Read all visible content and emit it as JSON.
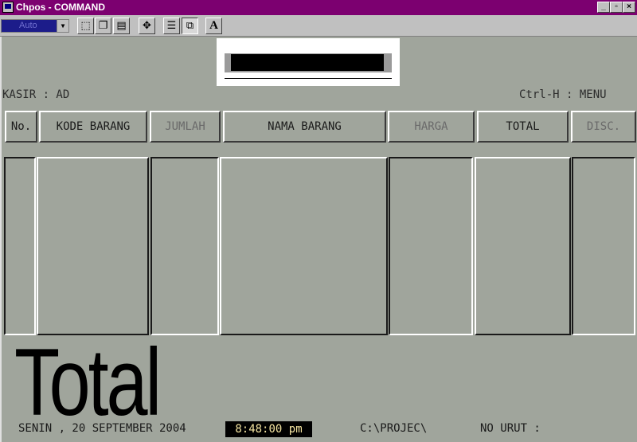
{
  "window": {
    "title": "Chpos - COMMAND",
    "controls": [
      "_",
      "▫",
      "×"
    ]
  },
  "toolbar": {
    "font_size_select": "Auto",
    "buttons": [
      {
        "name": "mark-button",
        "glyph": "⬚"
      },
      {
        "name": "copy-button",
        "glyph": "❐"
      },
      {
        "name": "paste-button",
        "glyph": "▤"
      },
      {
        "name": "fullscreen-button",
        "glyph": "✥"
      },
      {
        "name": "properties-button",
        "glyph": "☰"
      },
      {
        "name": "background-button",
        "glyph": "⧉"
      },
      {
        "name": "font-button",
        "glyph": "A"
      }
    ]
  },
  "pos": {
    "barcode_value": "",
    "kasir": "KASIR : AD",
    "menu_hint": "Ctrl-H : MENU",
    "columns": [
      "No.",
      "KODE BARANG",
      "JUMLAH",
      "NAMA BARANG",
      "HARGA",
      "TOTAL",
      "DISC."
    ],
    "total_label": "Total"
  },
  "status": {
    "date": "SENIN , 20 SEPTEMBER 2004",
    "time": "8:48:00 pm",
    "path": "C:\\PROJEC\\",
    "no_urut": "NO URUT :"
  },
  "colors": {
    "titlebar": "#7c0070",
    "background": "#a0a59c",
    "clock_text": "#f4e4a0"
  }
}
